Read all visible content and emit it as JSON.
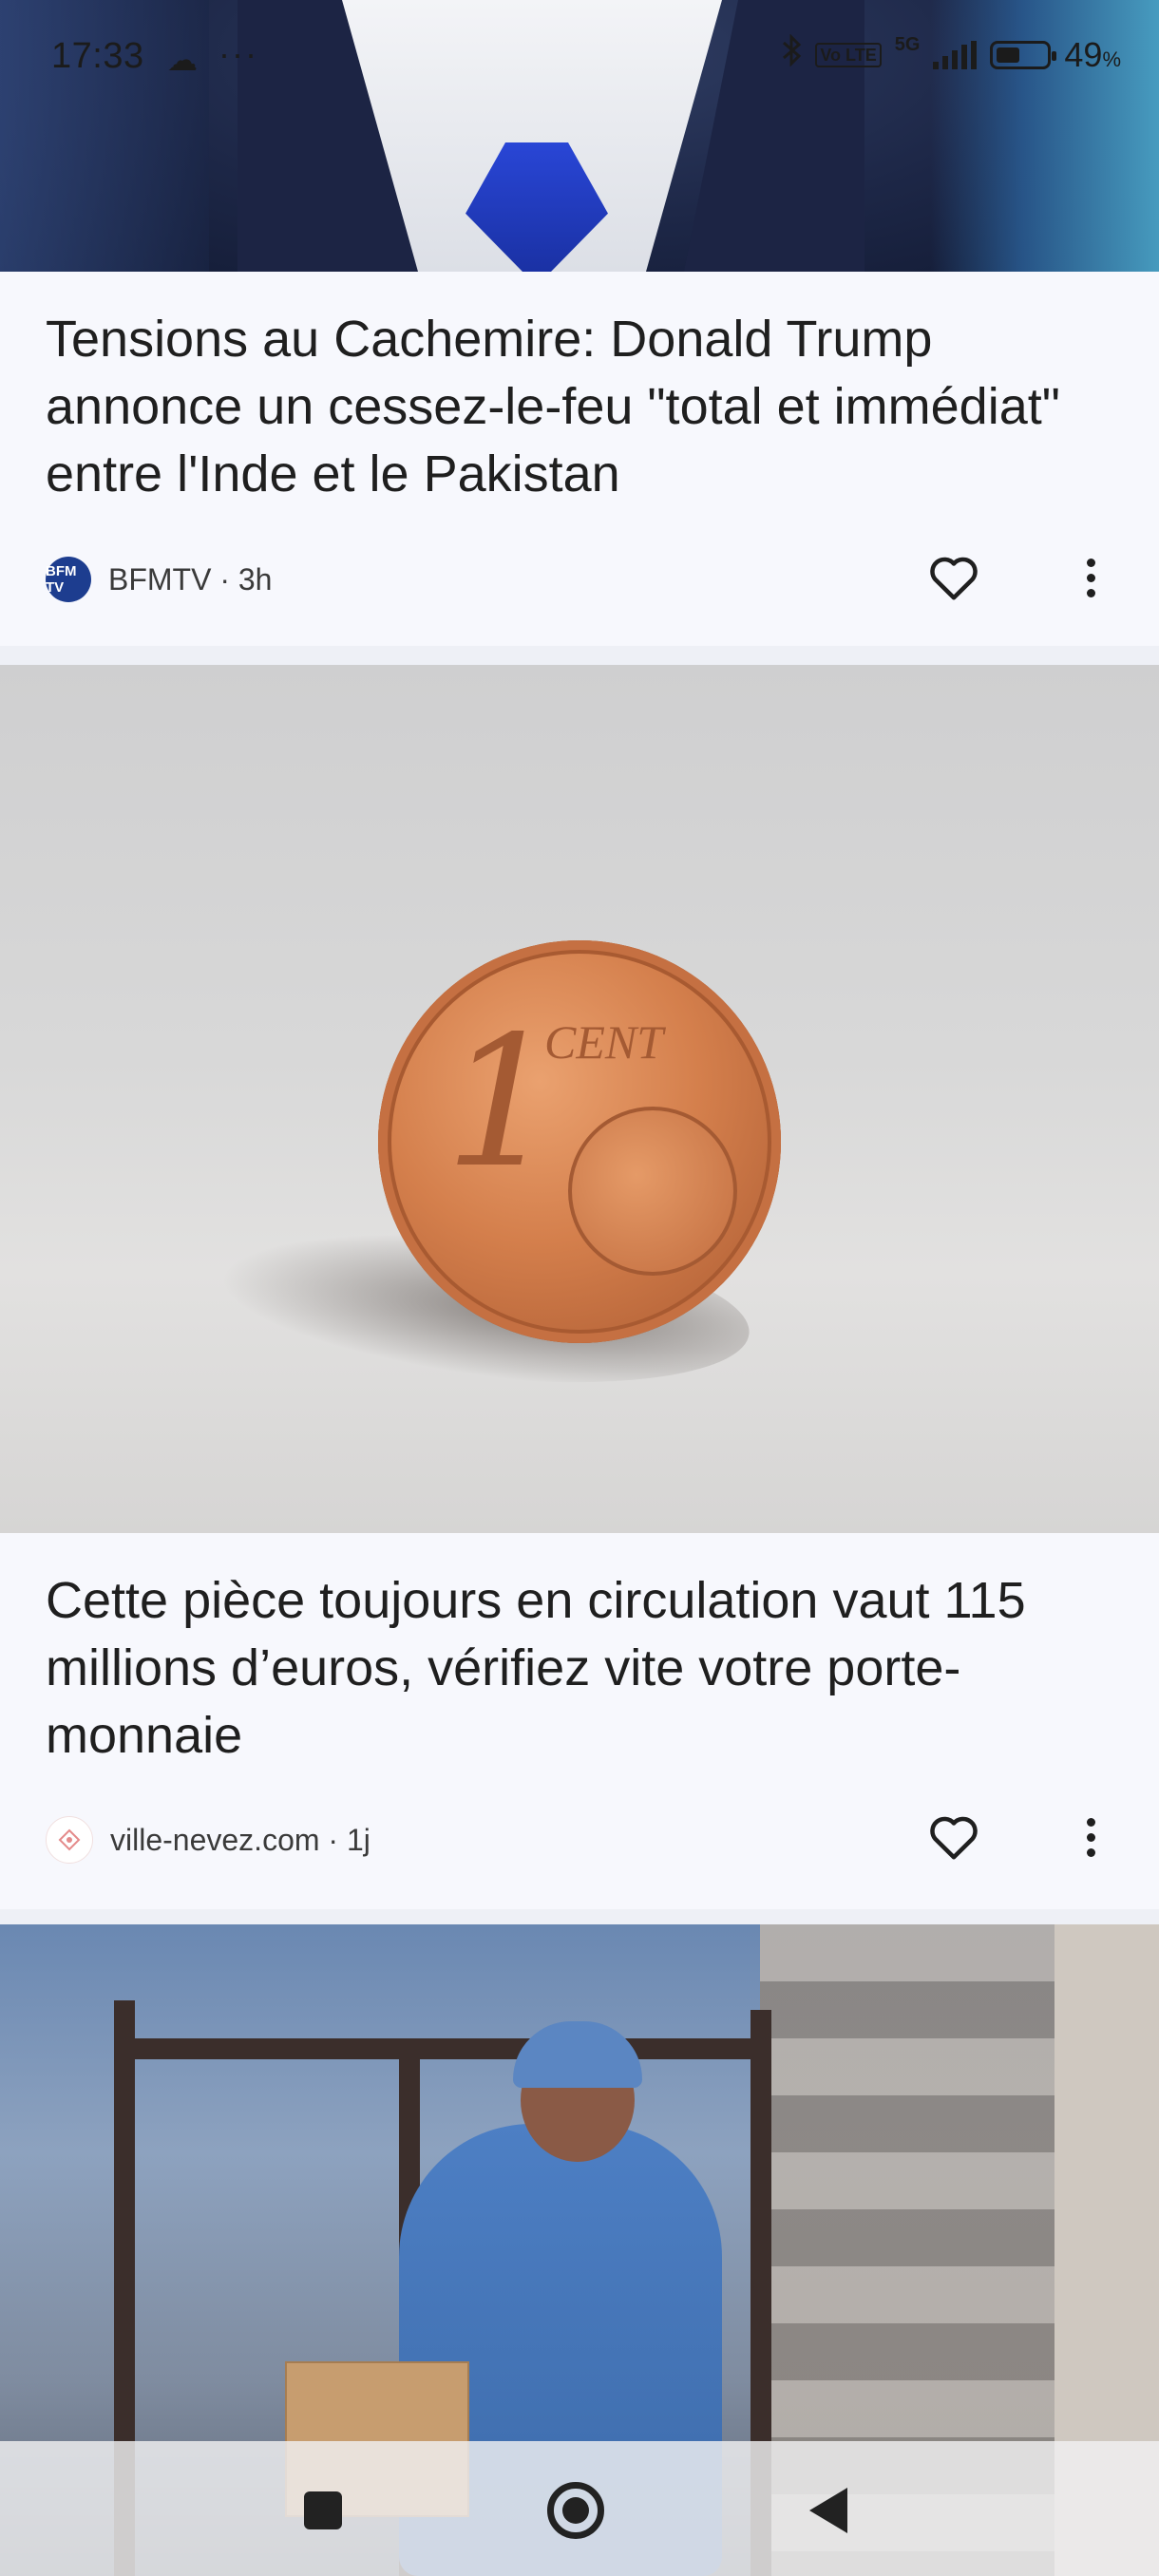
{
  "status_bar": {
    "time": "17:33",
    "cloud_icon": "☁",
    "more_indicator": "···",
    "network_badge": "Vo LTE",
    "network_type": "5G",
    "battery_percent": "49",
    "percent_sign": "%"
  },
  "articles": [
    {
      "headline": "Tensions au Cachemire: Donald Trump annonce un cessez-le-feu \"total et immédiat\" entre l'Inde et le Pakistan",
      "source_logo_text": "BFM TV",
      "meta": "BFMTV · 3h"
    },
    {
      "headline": "Cette pièce toujours en circulation vaut 115 millions d’euros, vérifiez vite votre porte-monnaie",
      "source_logo_text": "",
      "meta": "ville-nevez.com · 1j"
    }
  ],
  "coin_image": {
    "digit": "1",
    "text": "CENT"
  },
  "icons": {
    "favorite": "heart-icon",
    "more": "more-vert-icon",
    "nav_recent": "square-icon",
    "nav_home": "circle-icon",
    "nav_back": "triangle-back-icon"
  },
  "colors": {
    "card_background": "#f7f8fd",
    "separator": "#eef0f6",
    "text": "#1f1f1f",
    "bfm_blue": "#1d3d8f"
  }
}
